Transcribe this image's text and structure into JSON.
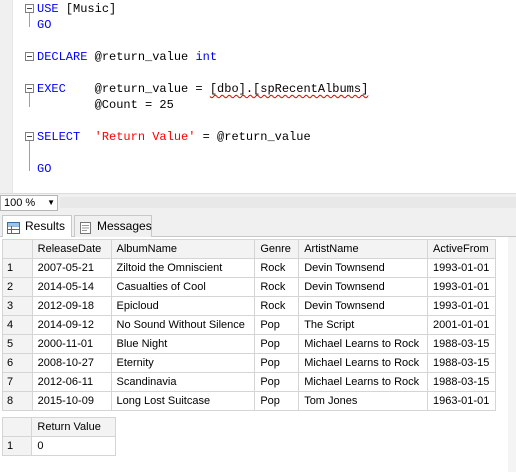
{
  "editor": {
    "lines": {
      "use_kw": "USE",
      "use_arg": " [Music]",
      "go1": "GO",
      "declare_kw": "DECLARE",
      "declare_var": " @return_value ",
      "declare_type": "int",
      "exec_kw": "EXEC",
      "exec_var": "    @return_value = ",
      "exec_proc": "[dbo].[spRecentAlbums]",
      "exec_param": "        @Count = 25",
      "select_kw": "SELECT",
      "select_str": "'Return Value'",
      "select_rest": " = @return_value",
      "go2": "GO"
    }
  },
  "zoom": {
    "value": "100 %"
  },
  "tabs": [
    {
      "label": "Results",
      "icon": "grid-icon",
      "active": true
    },
    {
      "label": "Messages",
      "icon": "message-icon",
      "active": false
    }
  ],
  "results_grid": {
    "columns": [
      "",
      "ReleaseDate",
      "AlbumName",
      "Genre",
      "ArtistName",
      "ActiveFrom"
    ],
    "rows": [
      [
        "1",
        "2007-05-21",
        "Ziltoid the Omniscient",
        "Rock",
        "Devin Townsend",
        "1993-01-01"
      ],
      [
        "2",
        "2014-05-14",
        "Casualties of Cool",
        "Rock",
        "Devin Townsend",
        "1993-01-01"
      ],
      [
        "3",
        "2012-09-18",
        "Epicloud",
        "Rock",
        "Devin Townsend",
        "1993-01-01"
      ],
      [
        "4",
        "2014-09-12",
        "No Sound Without Silence",
        "Pop",
        "The Script",
        "2001-01-01"
      ],
      [
        "5",
        "2000-11-01",
        "Blue Night",
        "Pop",
        "Michael Learns to Rock",
        "1988-03-15"
      ],
      [
        "6",
        "2008-10-27",
        "Eternity",
        "Pop",
        "Michael Learns to Rock",
        "1988-03-15"
      ],
      [
        "7",
        "2012-06-11",
        "Scandinavia",
        "Pop",
        "Michael Learns to Rock",
        "1988-03-15"
      ],
      [
        "8",
        "2015-10-09",
        "Long Lost Suitcase",
        "Pop",
        "Tom Jones",
        "1963-01-01"
      ]
    ]
  },
  "return_grid": {
    "columns": [
      "",
      "Return Value"
    ],
    "rows": [
      [
        "1",
        "0"
      ]
    ]
  }
}
